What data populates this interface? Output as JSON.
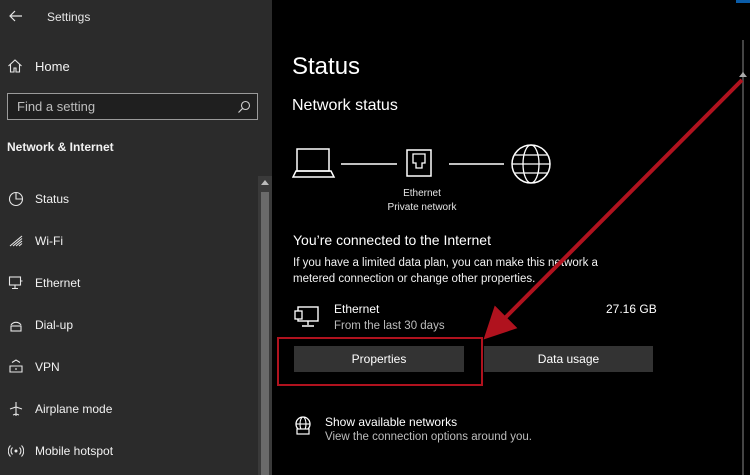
{
  "window": {
    "title": "Settings"
  },
  "sidebar": {
    "home_label": "Home",
    "search_placeholder": "Find a setting",
    "section_title": "Network & Internet",
    "items": [
      {
        "label": "Status",
        "icon": "status-icon"
      },
      {
        "label": "Wi-Fi",
        "icon": "wifi-icon"
      },
      {
        "label": "Ethernet",
        "icon": "ethernet-icon"
      },
      {
        "label": "Dial-up",
        "icon": "dialup-icon"
      },
      {
        "label": "VPN",
        "icon": "vpn-icon"
      },
      {
        "label": "Airplane mode",
        "icon": "airplane-icon"
      },
      {
        "label": "Mobile hotspot",
        "icon": "hotspot-icon"
      }
    ]
  },
  "main": {
    "page_title": "Status",
    "network_status_title": "Network status",
    "diagram": {
      "adapter_name": "Ethernet",
      "network_type": "Private network"
    },
    "connected_title": "You’re connected to the Internet",
    "connected_desc": "If you have a limited data plan, you can make this network a metered connection or change other properties.",
    "usage": {
      "name": "Ethernet",
      "period": "From the last 30 days",
      "amount": "27.16 GB"
    },
    "buttons": {
      "properties": "Properties",
      "data_usage": "Data usage"
    },
    "available_networks": {
      "title": "Show available networks",
      "desc": "View the connection options around you."
    }
  },
  "colors": {
    "annotation": "#b0121e",
    "sidebar_bg": "#2b2b2b",
    "main_bg": "#000000",
    "button_bg": "#333333",
    "accent": "#0a5ca8"
  }
}
